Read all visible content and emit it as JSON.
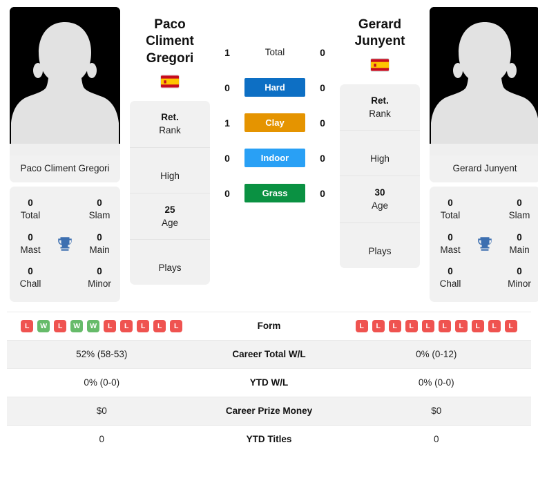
{
  "players": {
    "left": {
      "name": "Paco Climent Gregori",
      "display_name_line1": "Paco Climent",
      "display_name_line2": "Gregori",
      "flag": "spain-flag",
      "avatar": "player-silhouette",
      "titles": [
        {
          "value": "0",
          "label": "Total"
        },
        {
          "value": "0",
          "label": "Slam"
        },
        {
          "value": "0",
          "label": "Mast"
        },
        {
          "value": "0",
          "label": "Main"
        },
        {
          "value": "0",
          "label": "Chall"
        },
        {
          "value": "0",
          "label": "Minor"
        }
      ],
      "info": [
        {
          "value": "Ret.",
          "label": "Rank"
        },
        {
          "value": "",
          "label": "High"
        },
        {
          "value": "25",
          "label": "Age"
        },
        {
          "value": "",
          "label": "Plays"
        }
      ],
      "form": [
        "L",
        "W",
        "L",
        "W",
        "W",
        "L",
        "L",
        "L",
        "L",
        "L"
      ],
      "career_total_wl": "52% (58-53)",
      "ytd_wl": "0% (0-0)",
      "career_prize_money": "$0",
      "ytd_titles": "0"
    },
    "right": {
      "name": "Gerard Junyent",
      "display_name_line1": "Gerard",
      "display_name_line2": "Junyent",
      "flag": "spain-flag",
      "avatar": "player-silhouette",
      "titles": [
        {
          "value": "0",
          "label": "Total"
        },
        {
          "value": "0",
          "label": "Slam"
        },
        {
          "value": "0",
          "label": "Mast"
        },
        {
          "value": "0",
          "label": "Main"
        },
        {
          "value": "0",
          "label": "Chall"
        },
        {
          "value": "0",
          "label": "Minor"
        }
      ],
      "info": [
        {
          "value": "Ret.",
          "label": "Rank"
        },
        {
          "value": "",
          "label": "High"
        },
        {
          "value": "30",
          "label": "Age"
        },
        {
          "value": "",
          "label": "Plays"
        }
      ],
      "form": [
        "L",
        "L",
        "L",
        "L",
        "L",
        "L",
        "L",
        "L",
        "L",
        "L"
      ],
      "career_total_wl": "0% (0-12)",
      "ytd_wl": "0% (0-0)",
      "career_prize_money": "$0",
      "ytd_titles": "0"
    }
  },
  "head_to_head": [
    {
      "label": "Total",
      "left": "1",
      "right": "0",
      "color": "",
      "style": "plain"
    },
    {
      "label": "Hard",
      "left": "0",
      "right": "0",
      "color": "#0d6fc4",
      "style": "bar"
    },
    {
      "label": "Clay",
      "left": "1",
      "right": "0",
      "color": "#e59400",
      "style": "bar"
    },
    {
      "label": "Indoor",
      "left": "0",
      "right": "0",
      "color": "#29a0f5",
      "style": "bar"
    },
    {
      "label": "Grass",
      "left": "0",
      "right": "0",
      "color": "#0a9142",
      "style": "bar"
    }
  ],
  "table_rows": [
    {
      "label": "Form",
      "left": "",
      "right": "",
      "type": "form",
      "shaded": false
    },
    {
      "label": "Career Total W/L",
      "left": "52% (58-53)",
      "right": "0% (0-12)",
      "type": "text",
      "shaded": true
    },
    {
      "label": "YTD W/L",
      "left": "0% (0-0)",
      "right": "0% (0-0)",
      "type": "text",
      "shaded": false
    },
    {
      "label": "Career Prize Money",
      "left": "$0",
      "right": "$0",
      "type": "text",
      "shaded": true
    },
    {
      "label": "YTD Titles",
      "left": "0",
      "right": "0",
      "type": "text",
      "shaded": false
    }
  ],
  "colors": {
    "hard": "#0d6fc4",
    "clay": "#e59400",
    "indoor": "#29a0f5",
    "grass": "#0a9142",
    "win_badge": "#66bb6a",
    "loss_badge": "#ef5350",
    "card_bg": "#f1f1f1",
    "trophy": "#3d6fb0"
  }
}
